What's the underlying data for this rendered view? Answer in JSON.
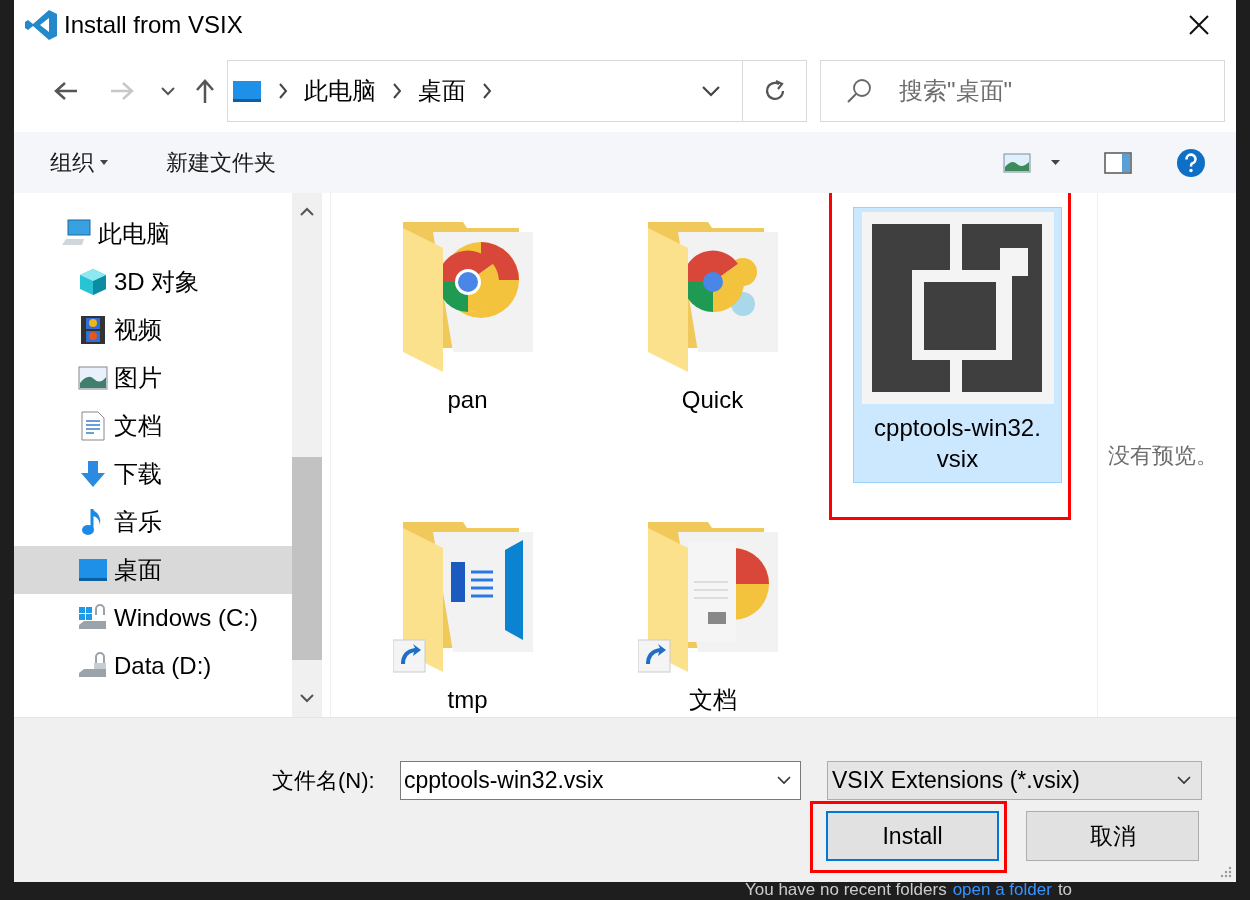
{
  "window": {
    "title": "Install from VSIX"
  },
  "nav": {
    "back_disabled": false,
    "forward_disabled": true,
    "breadcrumb": [
      "此电脑",
      "桌面"
    ],
    "search_placeholder": "搜索\"桌面\""
  },
  "toolbar": {
    "buttons": [
      {
        "label": "组织",
        "kind": "menu"
      },
      {
        "label": "新建文件夹",
        "kind": "plain"
      }
    ]
  },
  "sidebar": {
    "items": [
      {
        "label": "此电脑",
        "selected": false,
        "children": [
          {
            "label": "3D 对象",
            "selected": false
          },
          {
            "label": "视频",
            "selected": false
          },
          {
            "label": "图片",
            "selected": false
          },
          {
            "label": "文档",
            "selected": false
          },
          {
            "label": "下载",
            "selected": false
          },
          {
            "label": "音乐",
            "selected": false
          },
          {
            "label": "桌面",
            "selected": true
          },
          {
            "label": "Windows (C:)",
            "selected": false
          },
          {
            "label": "Data (D:)",
            "selected": false
          }
        ]
      }
    ]
  },
  "files": [
    {
      "name": "pan",
      "kind": "folder",
      "shortcut": false,
      "selected": false,
      "highlighted": false
    },
    {
      "name": "Quick",
      "kind": "folder",
      "shortcut": false,
      "selected": false,
      "highlighted": false
    },
    {
      "name": "cpptools-win32.vsix",
      "kind": "vsix",
      "shortcut": false,
      "selected": true,
      "highlighted": true
    },
    {
      "name": "tmp",
      "kind": "folder",
      "shortcut": true,
      "selected": false,
      "highlighted": false
    },
    {
      "name": "文档",
      "kind": "folder",
      "shortcut": true,
      "selected": false,
      "highlighted": false
    }
  ],
  "preview": {
    "message": "没有预览。"
  },
  "footer": {
    "filename_label": "文件名(N):",
    "filename": "cpptools-win32.vsix",
    "filter": "VSIX Extensions (*.vsix)",
    "buttons": [
      {
        "label": "Install",
        "default": true,
        "highlighted": true
      },
      {
        "label": "取消",
        "default": false,
        "highlighted": false
      }
    ]
  },
  "background": {
    "text": "You have no recent folders",
    "link": "open a folder",
    "tail": "to"
  }
}
